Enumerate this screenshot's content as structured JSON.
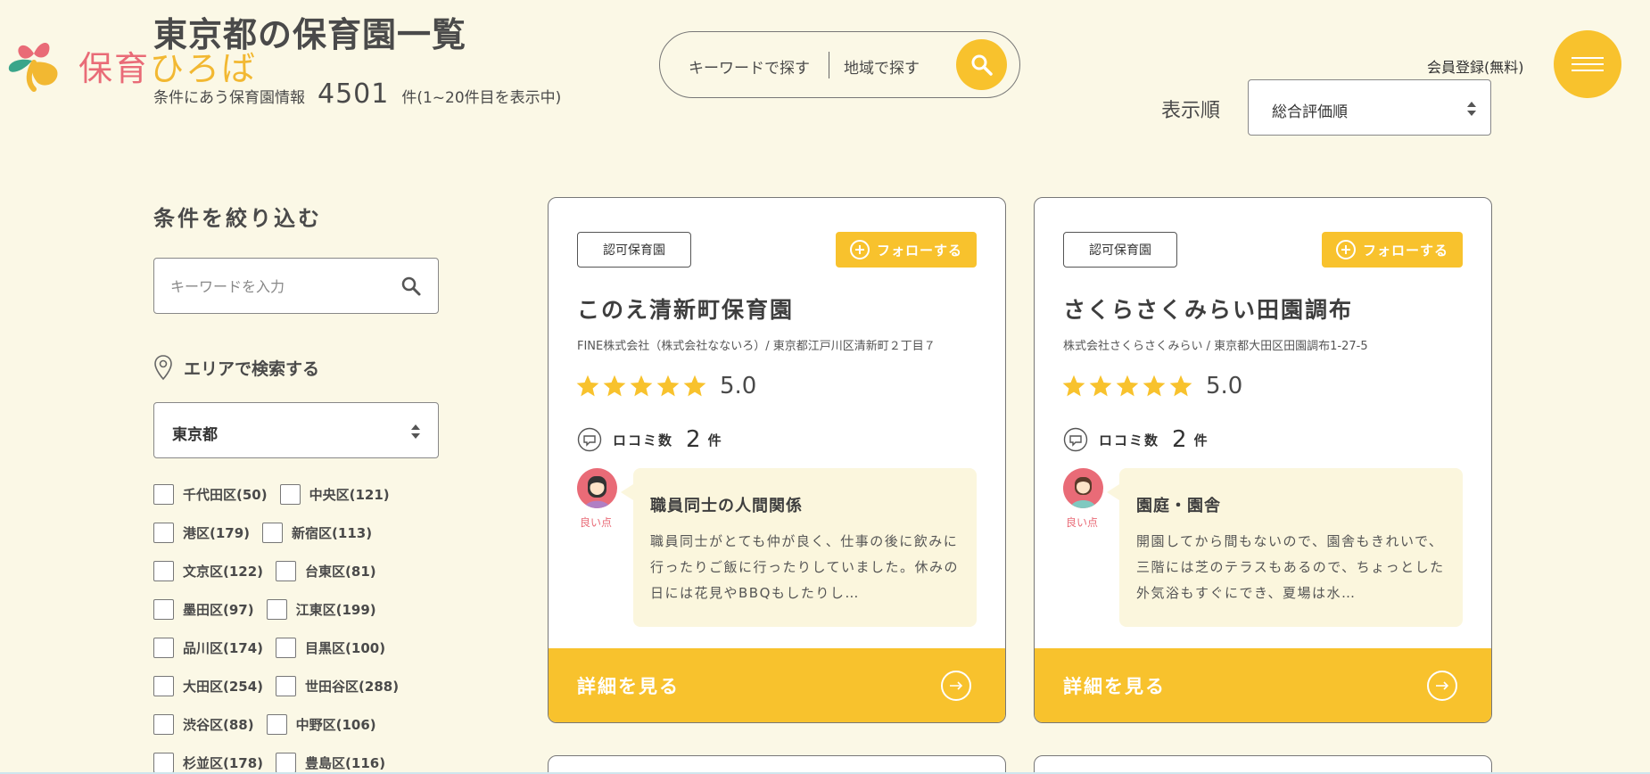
{
  "brand": {
    "logo_part1": "保育",
    "logo_part2": "ひろば",
    "colors": {
      "pink": "#e96b77",
      "yellow": "#f8c22d",
      "green": "#3aa58a",
      "background": "#fbf8e6"
    }
  },
  "header": {
    "title": "東京都の保育園一覧",
    "result_prefix": "条件にあう保育園情報",
    "result_count": "4501",
    "result_suffix": "件(1~20件目を表示中)",
    "search": {
      "keyword_label": "キーワードで探す",
      "area_label": "地域で探す",
      "button_icon": "search-icon"
    },
    "member_link": "会員登録(無料)",
    "menu_icon": "hamburger-icon",
    "sort_label": "表示順",
    "sort_value": "総合評価順"
  },
  "sidebar": {
    "title": "条件を絞り込む",
    "keyword_placeholder": "キーワードを入力",
    "area_heading": "エリアで検索する",
    "prefecture": "東京都",
    "wards": [
      [
        "千代田区(50)",
        "中央区(121)"
      ],
      [
        "港区(179)",
        "新宿区(113)"
      ],
      [
        "文京区(122)",
        "台東区(81)"
      ],
      [
        "墨田区(97)",
        "江東区(199)"
      ],
      [
        "品川区(174)",
        "目黒区(100)"
      ],
      [
        "大田区(254)",
        "世田谷区(288)"
      ],
      [
        "渋谷区(88)",
        "中野区(106)"
      ],
      [
        "杉並区(178)",
        "豊島区(116)"
      ]
    ]
  },
  "cards": [
    {
      "tag": "認可保育園",
      "follow": "フォローする",
      "name": "このえ清新町保育園",
      "sub": "FINE株式会社（株式会社なないろ）/ 東京都江戸川区清新町２丁目７",
      "rating": "5.0",
      "reviews_label": "ロコミ数",
      "reviews_count": "2",
      "reviews_unit": "件",
      "good_label": "良い点",
      "review_title": "職員同士の人間関係",
      "review_text": "職員同士がとても仲が良く、仕事の後に飲みに行ったりご飯に行ったりしていました。休みの日には花見やBBQもしたりし…",
      "detail": "詳細を見る"
    },
    {
      "tag": "認可保育園",
      "follow": "フォローする",
      "name": "さくらさくみらい田園調布",
      "sub": "株式会社さくらさくみらい / 東京都大田区田園調布1-27-5",
      "rating": "5.0",
      "reviews_label": "ロコミ数",
      "reviews_count": "2",
      "reviews_unit": "件",
      "good_label": "良い点",
      "review_title": "園庭・園舎",
      "review_text": "開園してから間もないので、園舎もきれいで、三階には芝のテラスもあるので、ちょっとした外気浴もすぐにでき、夏場は水…",
      "detail": "詳細を見る"
    }
  ]
}
